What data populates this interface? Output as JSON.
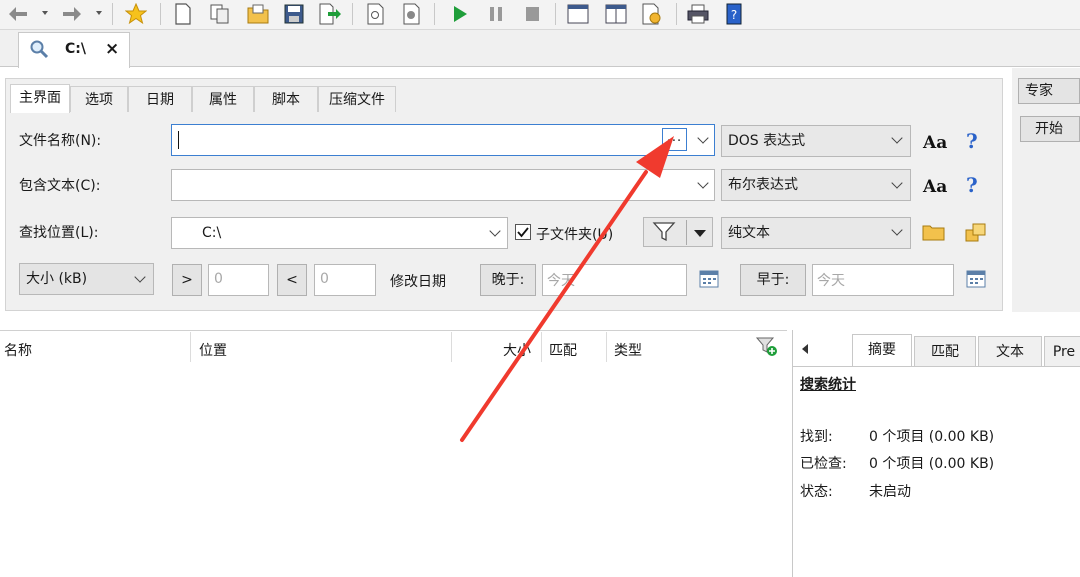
{
  "document_tab": {
    "title": "C:\\",
    "close": "×"
  },
  "criteria_tabs": [
    "主界面",
    "选项",
    "日期",
    "属性",
    "脚本",
    "压缩文件"
  ],
  "labels": {
    "file_name": "文件名称(N):",
    "contains_text": "包含文本(C):",
    "look_in": "查找位置(L):",
    "subfolders": "子文件夹(U)",
    "modified_date": "修改日期"
  },
  "inputs": {
    "file_name_value": "",
    "contains_text_value": "",
    "look_in_value": "C:\\",
    "browse_button": "...",
    "size_min": "0",
    "size_max": "0",
    "after_date_placeholder": "今天",
    "before_date_placeholder": "今天"
  },
  "combos": {
    "file_name_mode": "DOS 表达式",
    "text_mode": "布尔表达式",
    "text_type": "纯文本",
    "size_unit": "大小 (kB)"
  },
  "buttons": {
    "greater": ">",
    "less": "<",
    "after": "晚于:",
    "before": "早于:",
    "expert": "专家",
    "start": "开始",
    "aa": "Aa",
    "help": "?"
  },
  "results_columns": [
    "名称",
    "位置",
    "大小",
    "匹配",
    "类型"
  ],
  "summary_tabs": [
    "摘要",
    "匹配",
    "文本",
    "Pre"
  ],
  "summary": {
    "heading": "搜索统计",
    "found_label": "找到:",
    "found_value": "0 个项目 (0.00 KB)",
    "checked_label": "已检查:",
    "checked_value": "0 个项目 (0.00 KB)",
    "status_label": "状态:",
    "status_value": "未启动"
  },
  "colors": {
    "accent": "#3c7fd1",
    "help": "#2a62c9",
    "annotation_arrow": "#f03a2e",
    "play": "#1f9e3a"
  }
}
